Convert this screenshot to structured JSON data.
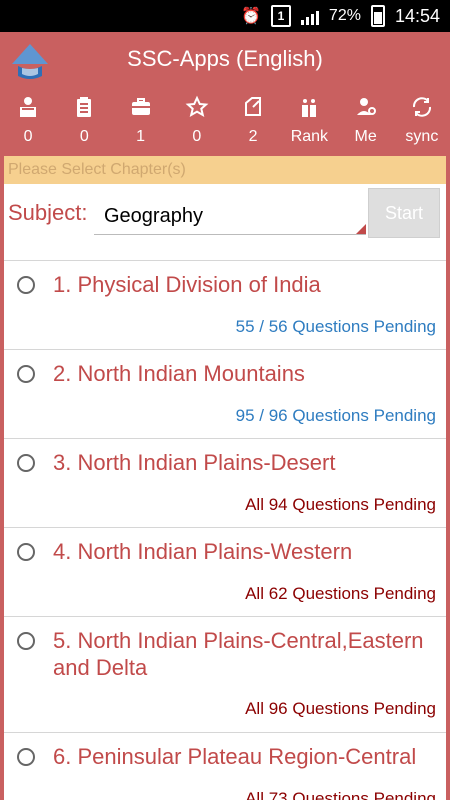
{
  "status": {
    "battery": "72%",
    "time": "14:54",
    "notification_badge": "1"
  },
  "header": {
    "title": "SSC-Apps (English)"
  },
  "metrics": [
    {
      "icon": "reading-icon",
      "label": "0"
    },
    {
      "icon": "clipboard-icon",
      "label": "0"
    },
    {
      "icon": "briefcase-icon",
      "label": "1"
    },
    {
      "icon": "star-icon",
      "label": "0"
    },
    {
      "icon": "edit-icon",
      "label": "2"
    },
    {
      "icon": "rank-icon",
      "label": "Rank"
    },
    {
      "icon": "profile-settings-icon",
      "label": "Me"
    },
    {
      "icon": "sync-icon",
      "label": "sync"
    }
  ],
  "notice": "Please Select Chapter(s)",
  "subject": {
    "label": "Subject:",
    "value": "Geography"
  },
  "start_label": "Start",
  "chapters": [
    {
      "title": "1. Physical Division of India",
      "pending": "55 / 56 Questions Pending",
      "color": "#2e7cc0"
    },
    {
      "title": "2. North Indian Mountains",
      "pending": "95 / 96 Questions Pending",
      "color": "#2e7cc0"
    },
    {
      "title": "3. North Indian Plains-Desert",
      "pending": "All 94 Questions Pending",
      "color": "#8b0000"
    },
    {
      "title": "4. North Indian Plains-Western",
      "pending": "All 62 Questions Pending",
      "color": "#8b0000"
    },
    {
      "title": "5. North Indian Plains-Central,Eastern and Delta",
      "pending": "All 96 Questions Pending",
      "color": "#8b0000"
    },
    {
      "title": "6. Peninsular Plateau Region-Central",
      "pending": "All 73 Questions Pending",
      "color": "#8b0000"
    }
  ]
}
